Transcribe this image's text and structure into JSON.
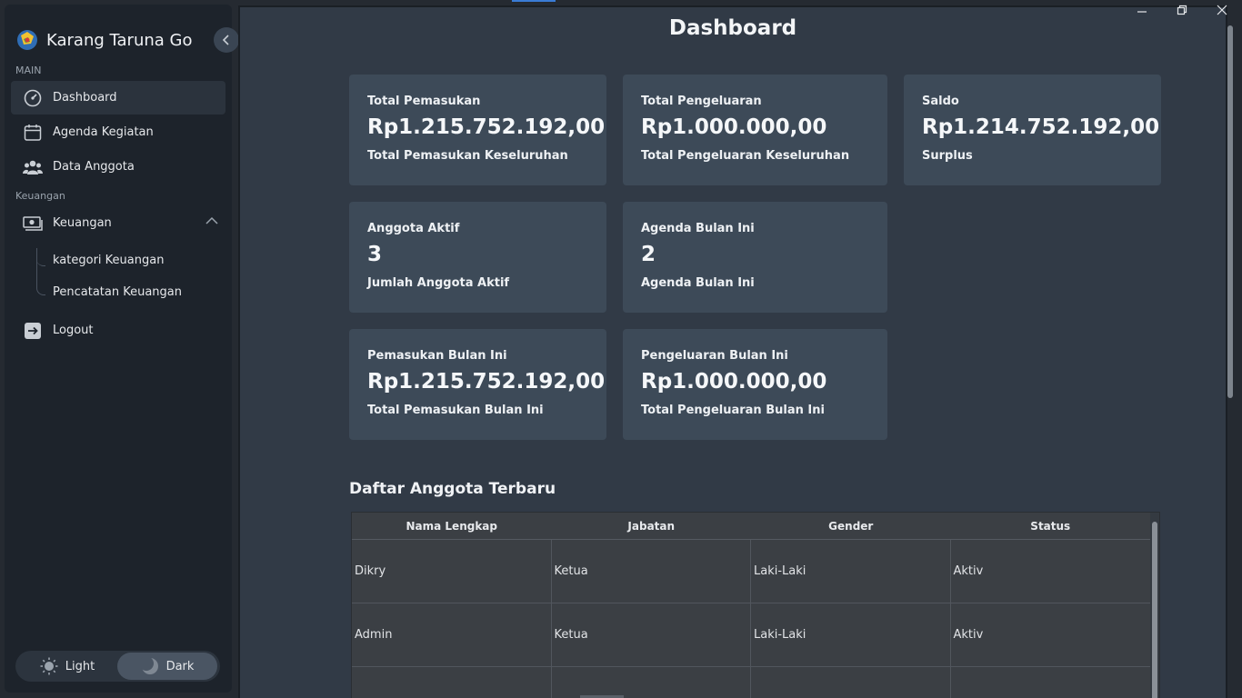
{
  "app": {
    "title": "Karang Taruna Go"
  },
  "sidebar": {
    "section_main": "MAIN",
    "section_finance": "Keuangan",
    "items": [
      {
        "label": "Dashboard",
        "icon": "dashboard-gauge-icon",
        "active": true
      },
      {
        "label": "Agenda Kegiatan",
        "icon": "calendar-icon",
        "active": false
      },
      {
        "label": "Data Anggota",
        "icon": "users-icon",
        "active": false
      }
    ],
    "finance": {
      "label": "Keuangan",
      "icon": "money-icon",
      "expanded": true,
      "children": [
        {
          "label": "kategori Keuangan"
        },
        {
          "label": "Pencatatan Keuangan"
        }
      ]
    },
    "logout": {
      "label": "Logout",
      "icon": "logout-icon"
    },
    "theme": {
      "light": "Light",
      "dark": "Dark",
      "selected": "dark"
    }
  },
  "main": {
    "title": "Dashboard",
    "cards": [
      {
        "title": "Total Pemasukan",
        "value": "Rp1.215.752.192,00",
        "subtitle": "Total Pemasukan Keseluruhan"
      },
      {
        "title": "Total Pengeluaran",
        "value": "Rp1.000.000,00",
        "subtitle": "Total Pengeluaran Keseluruhan"
      },
      {
        "title": "Saldo",
        "value": "Rp1.214.752.192,00",
        "subtitle": "Surplus"
      },
      {
        "title": "Anggota Aktif",
        "value": "3",
        "subtitle": "Jumlah Anggota Aktif"
      },
      {
        "title": "Agenda Bulan Ini",
        "value": "2",
        "subtitle": "Agenda Bulan Ini"
      },
      {
        "title": "Pemasukan Bulan Ini",
        "value": "Rp1.215.752.192,00",
        "subtitle": "Total Pemasukan Bulan Ini"
      },
      {
        "title": "Pengeluaran Bulan Ini",
        "value": "Rp1.000.000,00",
        "subtitle": "Total Pengeluaran Bulan Ini"
      }
    ],
    "members_section": {
      "title": "Daftar Anggota Terbaru",
      "columns": [
        "Nama Lengkap",
        "Jabatan",
        "Gender",
        "Status"
      ],
      "rows": [
        [
          "Dikry",
          "Ketua",
          "Laki-Laki",
          "Aktiv"
        ],
        [
          "Admin",
          "Ketua",
          "Laki-Laki",
          "Aktiv"
        ],
        [
          "",
          "",
          "",
          ""
        ]
      ]
    }
  },
  "colors": {
    "sidebar_bg": "#1d232b",
    "main_bg": "#313a46",
    "card_bg": "#3d4a58",
    "accent": "#3a7bd5"
  }
}
